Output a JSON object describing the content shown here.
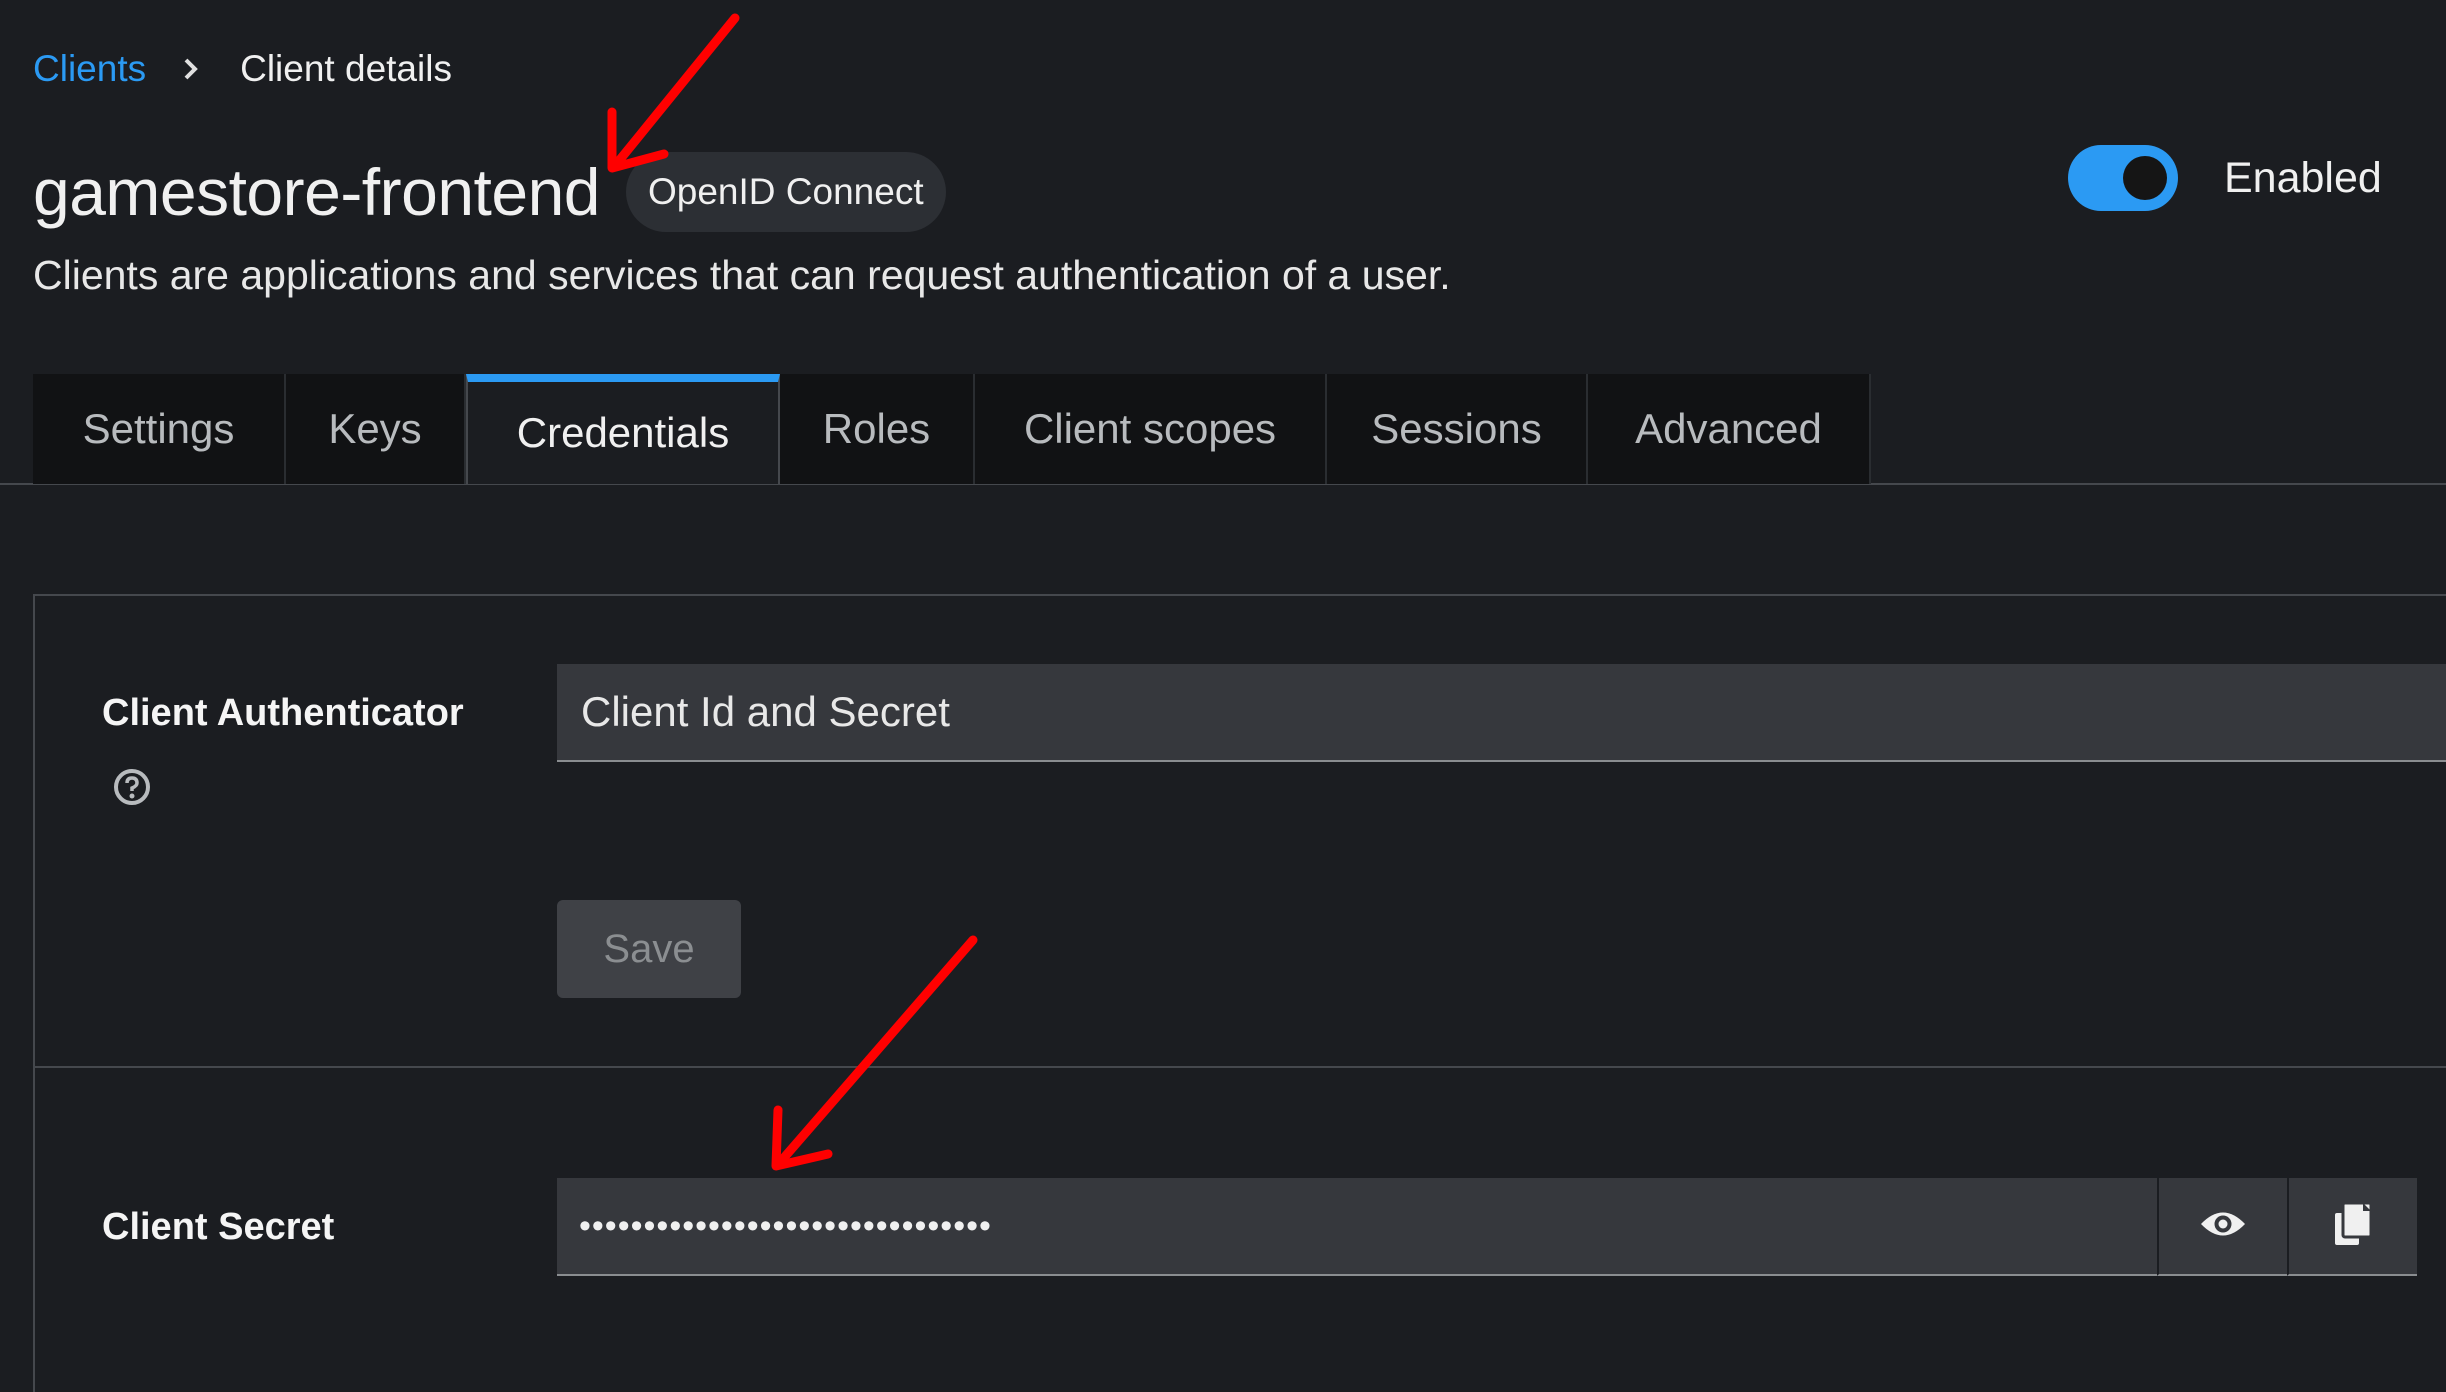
{
  "breadcrumb": {
    "parent": "Clients",
    "current": "Client details"
  },
  "header": {
    "title": "gamestore-frontend",
    "protocol_badge": "OpenID Connect",
    "subtitle": "Clients are applications and services that can request authentication of a user.",
    "enabled_label": "Enabled",
    "enabled": true
  },
  "tabs": [
    {
      "label": "Settings",
      "active": false
    },
    {
      "label": "Keys",
      "active": false
    },
    {
      "label": "Credentials",
      "active": true
    },
    {
      "label": "Roles",
      "active": false
    },
    {
      "label": "Client scopes",
      "active": false
    },
    {
      "label": "Sessions",
      "active": false
    },
    {
      "label": "Advanced",
      "active": false
    }
  ],
  "credentials": {
    "authenticator_label": "Client Authenticator",
    "authenticator_value": "Client Id and Secret",
    "save_label": "Save",
    "secret_label": "Client Secret",
    "secret_masked": "••••••••••••••••••••••••••••••••"
  },
  "colors": {
    "accent": "#2b9af3",
    "background": "#1b1d21",
    "annotation_arrow": "#ff0000"
  },
  "icons": {
    "breadcrumb_separator": "chevron-right-icon",
    "help": "help-circle-icon",
    "reveal": "eye-icon",
    "copy": "copy-icon"
  }
}
